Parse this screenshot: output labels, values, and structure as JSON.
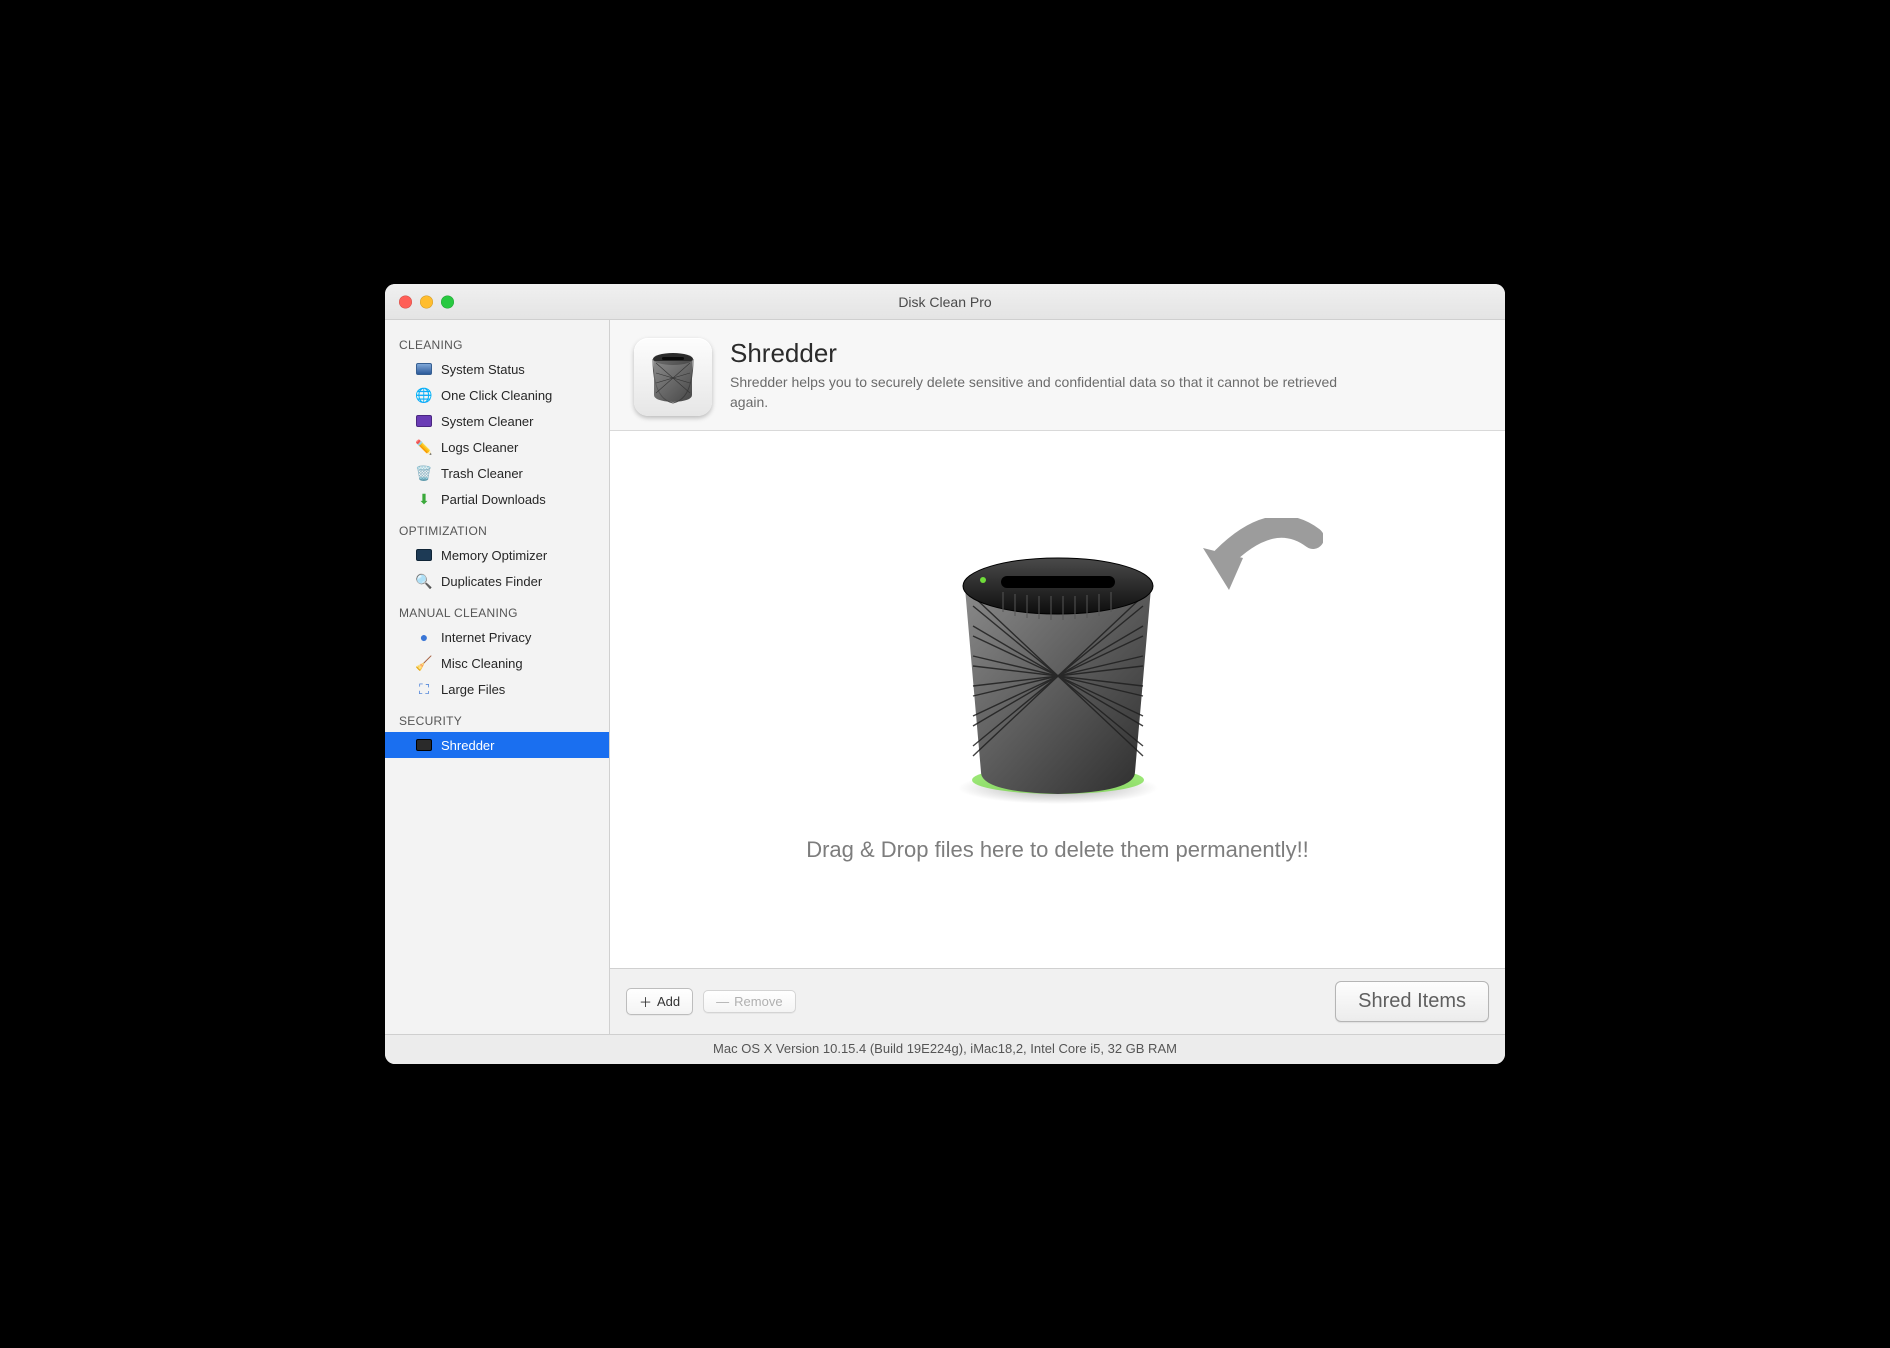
{
  "window": {
    "title": "Disk Clean Pro"
  },
  "sidebar": {
    "sections": [
      {
        "title": "CLEANING",
        "items": [
          {
            "label": "System Status",
            "icon": "monitor-icon",
            "selected": false
          },
          {
            "label": "One Click Cleaning",
            "icon": "globe-refresh-icon",
            "selected": false
          },
          {
            "label": "System Cleaner",
            "icon": "chip-icon",
            "selected": false
          },
          {
            "label": "Logs Cleaner",
            "icon": "pencil-note-icon",
            "selected": false
          },
          {
            "label": "Trash Cleaner",
            "icon": "trash-tiny-icon",
            "selected": false
          },
          {
            "label": "Partial Downloads",
            "icon": "download-arrow-icon",
            "selected": false
          }
        ]
      },
      {
        "title": "OPTIMIZATION",
        "items": [
          {
            "label": "Memory Optimizer",
            "icon": "ram-icon",
            "selected": false
          },
          {
            "label": "Duplicates Finder",
            "icon": "duplicate-icon",
            "selected": false
          }
        ]
      },
      {
        "title": "MANUAL CLEANING",
        "items": [
          {
            "label": "Internet Privacy",
            "icon": "globe-icon",
            "selected": false
          },
          {
            "label": "Misc Cleaning",
            "icon": "broom-icon",
            "selected": false
          },
          {
            "label": "Large Files",
            "icon": "expand-icon",
            "selected": false
          }
        ]
      },
      {
        "title": "SECURITY",
        "items": [
          {
            "label": "Shredder",
            "icon": "shredder-tiny-icon",
            "selected": true
          }
        ]
      }
    ]
  },
  "header": {
    "title": "Shredder",
    "description": "Shredder helps you to securely delete sensitive and confidential data so that it cannot be retrieved again."
  },
  "dropzone": {
    "text": "Drag & Drop files here to delete them permanently!!"
  },
  "footer": {
    "add_label": "Add",
    "remove_label": "Remove",
    "shred_label": "Shred Items"
  },
  "statusbar": {
    "text": "Mac OS X Version 10.15.4 (Build 19E224g), iMac18,2, Intel Core i5, 32 GB RAM"
  }
}
